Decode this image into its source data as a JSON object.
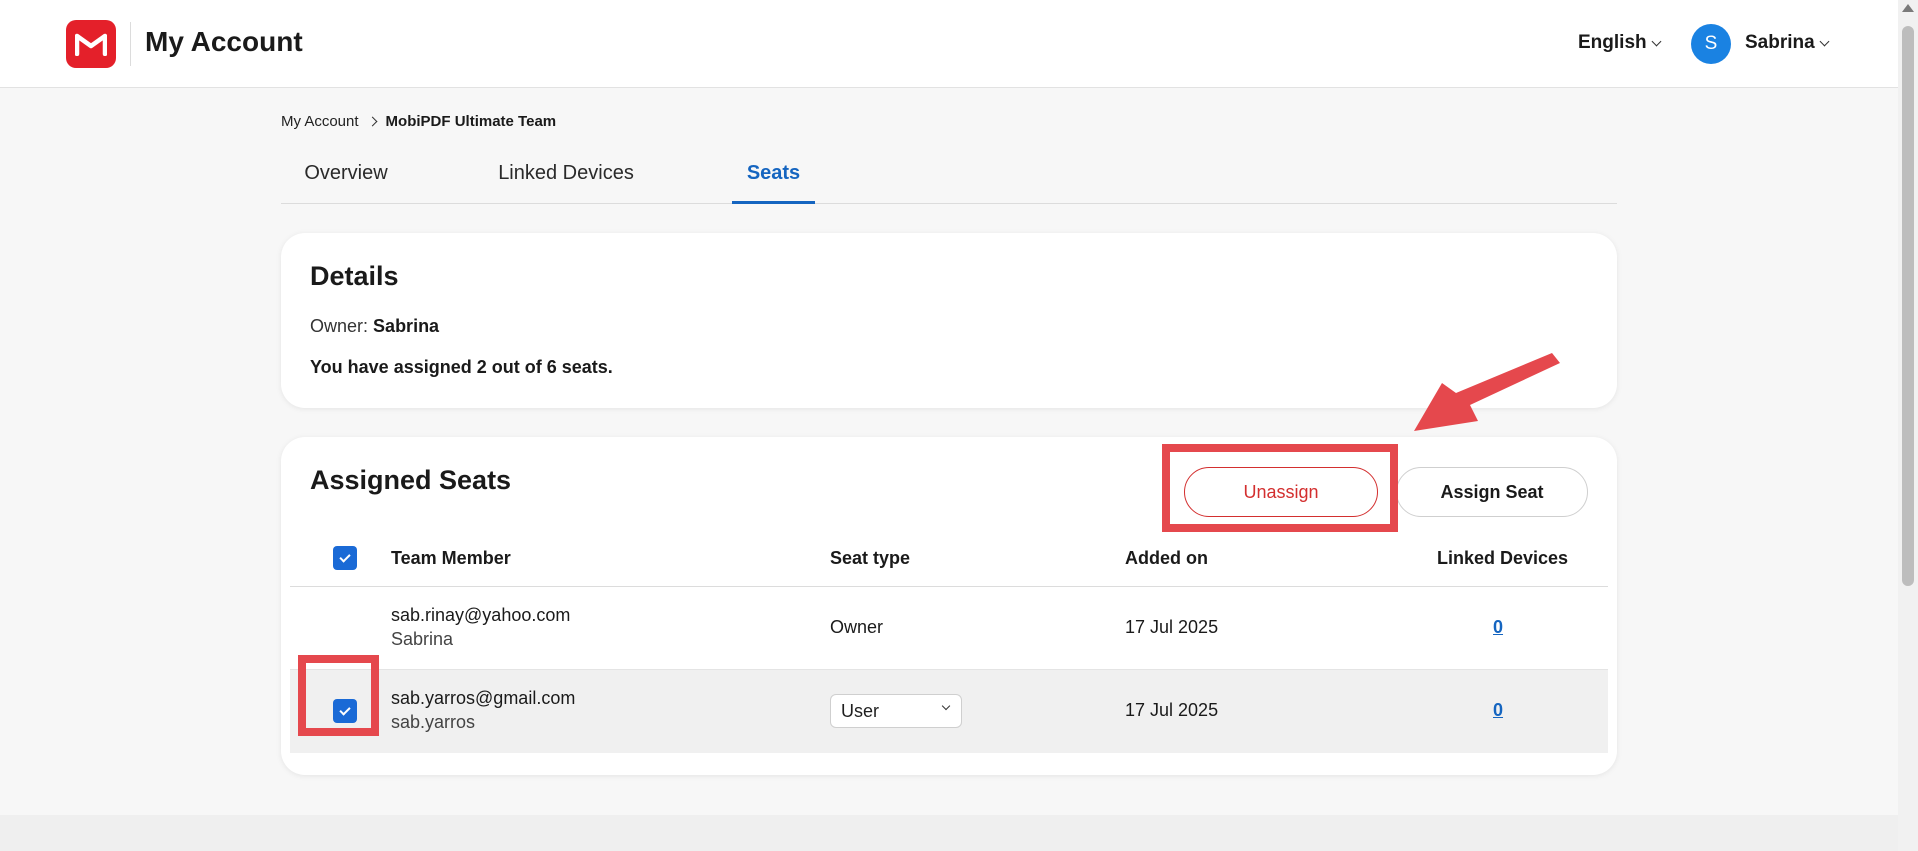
{
  "header": {
    "app_title": "My Account",
    "language": "English",
    "user": {
      "initial": "S",
      "name": "Sabrina"
    }
  },
  "breadcrumb": {
    "parent": "My Account",
    "current": "MobiPDF Ultimate Team"
  },
  "tabs": [
    {
      "label": "Overview",
      "active": false
    },
    {
      "label": "Linked Devices",
      "active": false
    },
    {
      "label": "Seats",
      "active": true
    }
  ],
  "details": {
    "title": "Details",
    "owner_label": "Owner:",
    "owner_name": "Sabrina",
    "assigned_text": "You have assigned 2 out of 6 seats."
  },
  "assigned_seats": {
    "title": "Assigned Seats",
    "unassign_label": "Unassign",
    "assign_label": "Assign Seat",
    "columns": [
      "Team Member",
      "Seat type",
      "Added on",
      "Linked Devices"
    ],
    "header_checked": true,
    "rows": [
      {
        "email": "sab.rinay@yahoo.com",
        "name": "Sabrina",
        "seat_type": "Owner",
        "added_on": "17 Jul 2025",
        "linked_devices": "0",
        "checked": false,
        "editable": false
      },
      {
        "email": "sab.yarros@gmail.com",
        "name": "sab.yarros",
        "seat_type": "User",
        "added_on": "17 Jul 2025",
        "linked_devices": "0",
        "checked": true,
        "editable": true
      }
    ]
  },
  "colors": {
    "brand": "#e4202a",
    "accent": "#1565c0",
    "checkbox": "#1a6ad6",
    "danger": "#d32f2f",
    "annotation": "#e5484d"
  }
}
